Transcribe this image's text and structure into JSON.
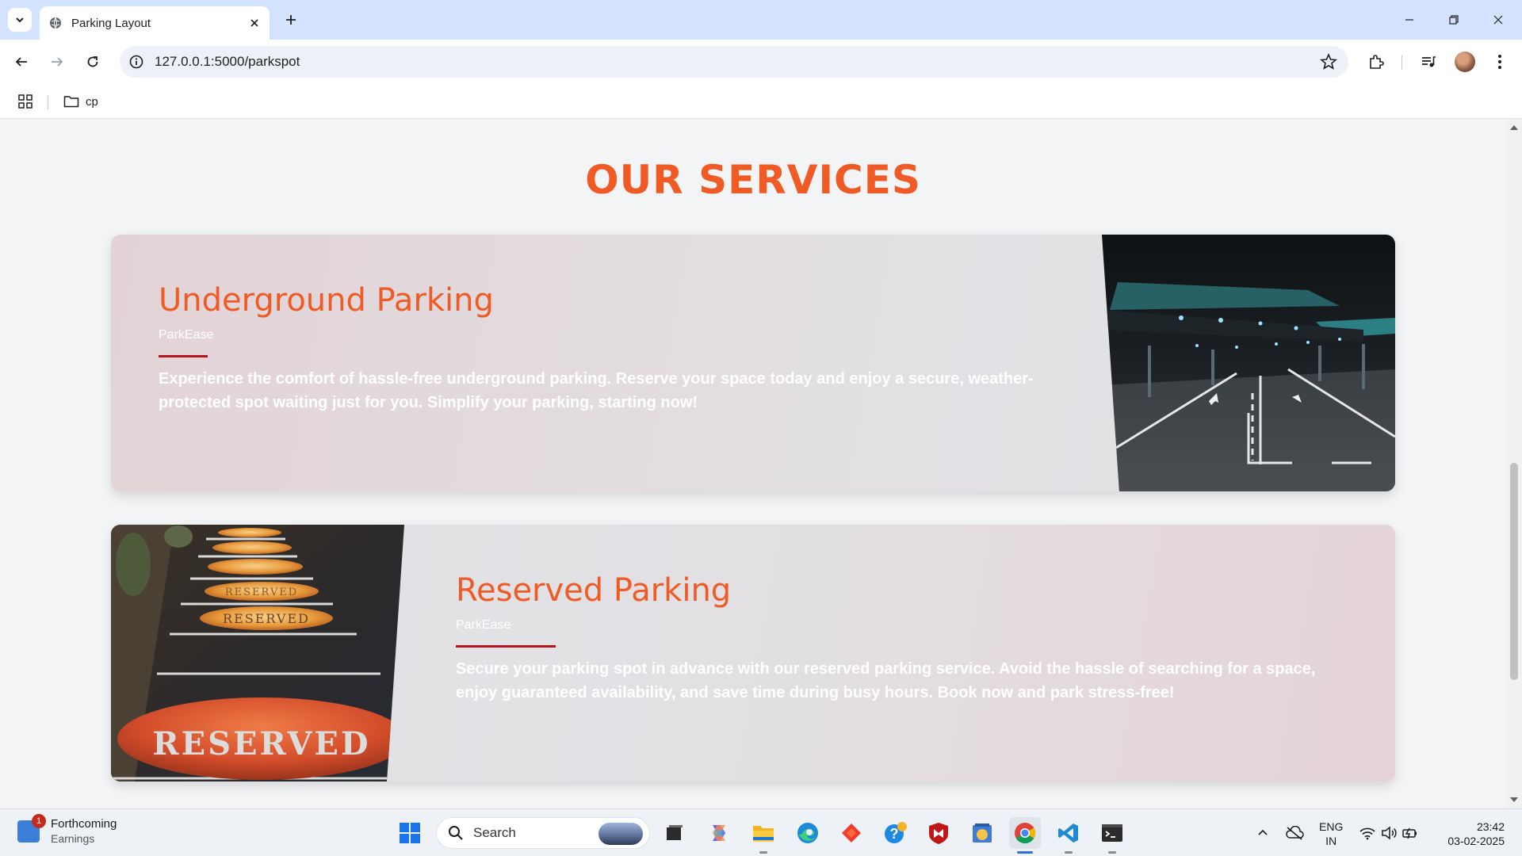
{
  "browser": {
    "tab_title": "Parking Layout",
    "url": "127.0.0.1:5000/parkspot",
    "bookmark_folder": "cp"
  },
  "page": {
    "section_title": "OUR SERVICES",
    "cards": [
      {
        "title": "Underground Parking",
        "brand": "ParkEase",
        "description": "Experience the comfort of hassle-free underground parking. Reserve your space today and enjoy a secure, weather-protected spot waiting just for you. Simplify your parking, starting now!",
        "image": "underground-parking-photo"
      },
      {
        "title": "Reserved Parking",
        "brand": "ParkEase",
        "description": "Secure your parking spot in advance with our reserved parking service. Avoid the hassle of searching for a space, enjoy guaranteed availability, and save time during busy hours. Book now and park stress-free!",
        "image": "reserved-parking-photo",
        "image_text": [
          "RESERVED",
          "RESERVED",
          "RESERVED"
        ]
      }
    ]
  },
  "taskbar": {
    "weather_title": "Forthcoming",
    "weather_sub": "Earnings",
    "notification_count": "1",
    "search_placeholder": "Search",
    "lang_line1": "ENG",
    "lang_line2": "IN",
    "time": "23:42",
    "date": "03-02-2025"
  },
  "colors": {
    "accent": "#f05a24",
    "rule": "#b3161b",
    "tab_strip": "#d3e3fd"
  }
}
